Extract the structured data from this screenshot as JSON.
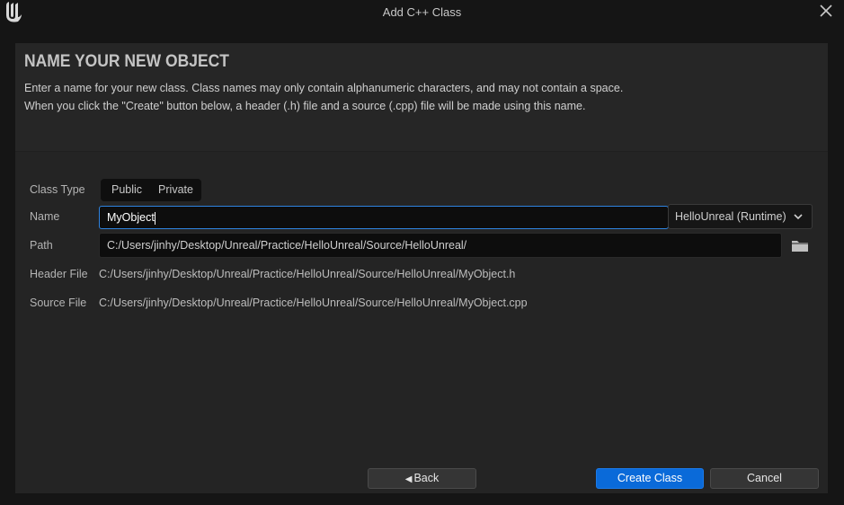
{
  "window": {
    "title": "Add C++ Class",
    "logo_icon": "unreal-logo-icon",
    "close_icon": "close-icon"
  },
  "header": {
    "heading": "NAME YOUR NEW OBJECT",
    "desc_line1": "Enter a name for your new class. Class names may only contain alphanumeric characters, and may not contain a space.",
    "desc_line2": "When you click the \"Create\" button below, a header (.h) file and a source (.cpp) file will be made using this name."
  },
  "form": {
    "class_type_label": "Class Type",
    "class_type_options": [
      "Public",
      "Private"
    ],
    "name_label": "Name",
    "name_value": "MyObject",
    "module_value": "HelloUnreal (Runtime)",
    "path_label": "Path",
    "path_value": "C:/Users/jinhy/Desktop/Unreal/Practice/HelloUnreal/Source/HelloUnreal/",
    "header_file_label": "Header File",
    "header_file_value": "C:/Users/jinhy/Desktop/Unreal/Practice/HelloUnreal/Source/HelloUnreal/MyObject.h",
    "source_file_label": "Source File",
    "source_file_value": "C:/Users/jinhy/Desktop/Unreal/Practice/HelloUnreal/Source/HelloUnreal/MyObject.cpp"
  },
  "footer": {
    "back_label": "Back",
    "create_label": "Create Class",
    "cancel_label": "Cancel"
  },
  "colors": {
    "accent": "#0a6ad9",
    "focus_border": "#2f84e0",
    "background": "#151515",
    "panel": "#242424"
  }
}
